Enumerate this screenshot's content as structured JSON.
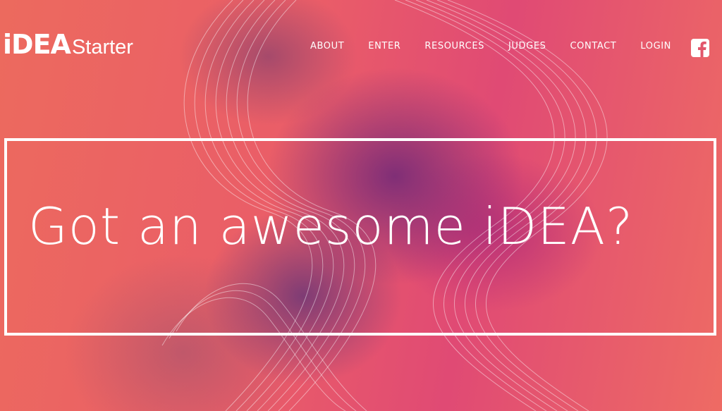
{
  "brand": {
    "logo_bold": "iDEA",
    "logo_light": "Starter"
  },
  "nav": {
    "items": [
      {
        "label": "ABOUT"
      },
      {
        "label": "ENTER"
      },
      {
        "label": "RESOURCES"
      },
      {
        "label": "JUDGES"
      },
      {
        "label": "CONTACT"
      },
      {
        "label": "LOGIN"
      }
    ],
    "social_icon": "facebook-icon"
  },
  "hero": {
    "headline": "Got an awesome iDEA?"
  },
  "colors": {
    "background": "#e8566a",
    "accent_purple": "#6e2878",
    "text": "#ffffff"
  }
}
